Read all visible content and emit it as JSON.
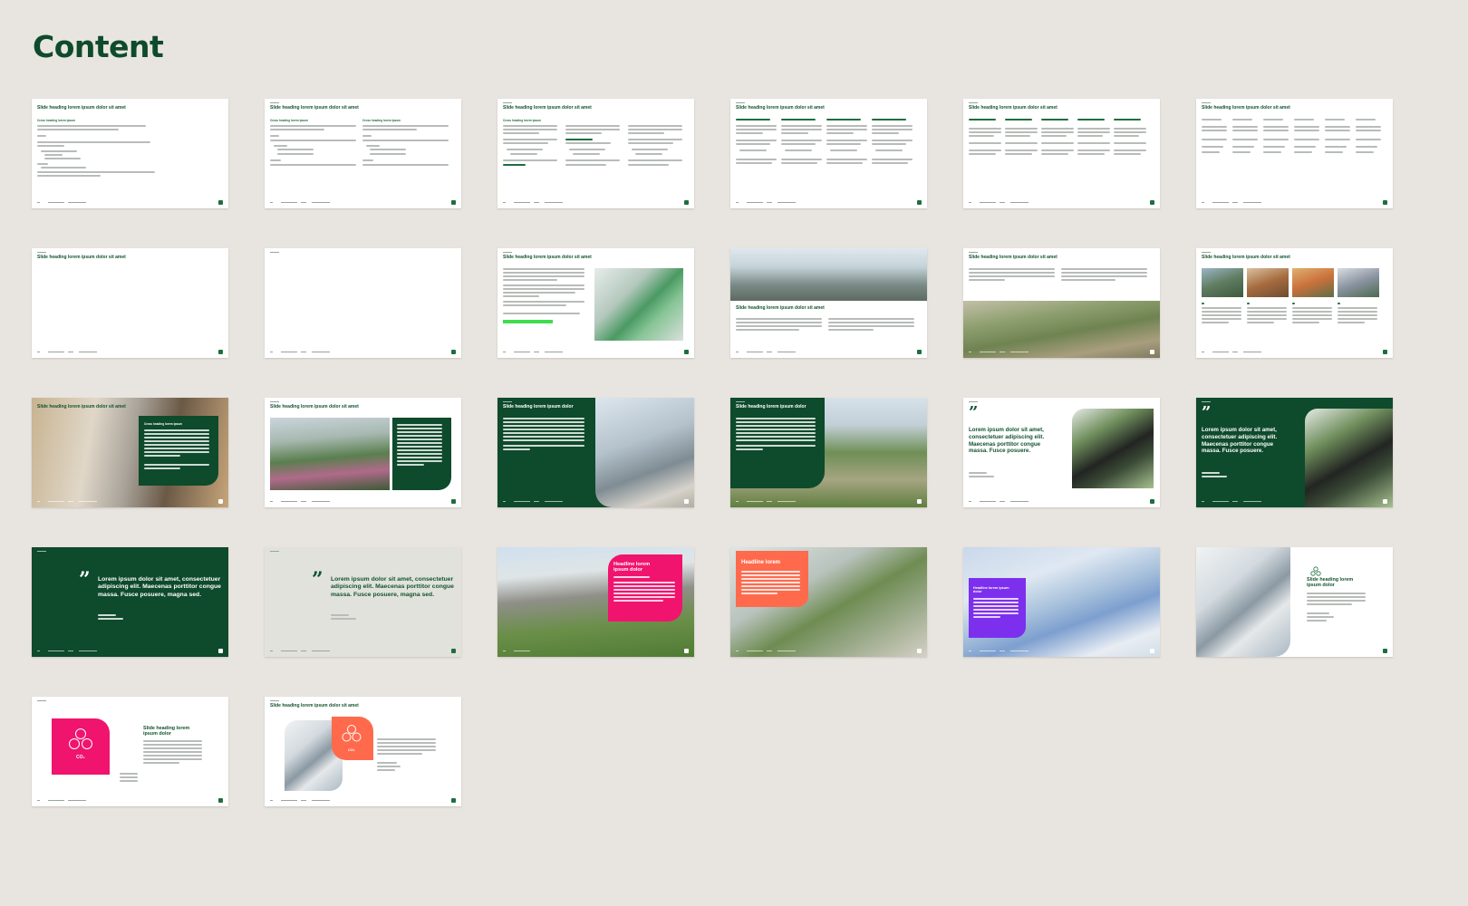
{
  "page": {
    "title": "Content"
  },
  "colors": {
    "background": "#e8e4df",
    "brand_green": "#0e4a2c",
    "accent_green": "#3fdc4f",
    "pink": "#f0146e",
    "coral": "#ff6a4d",
    "violet": "#7d2fee",
    "pale": "#e1e2dc"
  },
  "text": {
    "slide_heading": "Slide heading lorem ipsum dolor sit amet",
    "slide_heading_short": "Slide heading lorem ipsum dolor",
    "cross_heading": "Cross heading lorem ipsum",
    "quote_long": "Lorem ipsum dolor sit amet, consectetuer adipiscing elit. Maecenas porttitor congue massa. Fusce posuere, magna sed.",
    "quote_short": "Lorem ipsum dolor sit amet, consectetuer adipiscing elit. Maecenas porttitor congue massa. Fusce posuere.",
    "headline_ipsum": "Headline lorem ipsum dolor",
    "headline": "Headline lorem",
    "slide_heading_two_line": "Slide heading lorem ipsum dolor",
    "co2": "CO₂"
  },
  "icons": {
    "quote": "quote-icon",
    "logo": "logo-icon",
    "molecule": "molecule-icon"
  }
}
